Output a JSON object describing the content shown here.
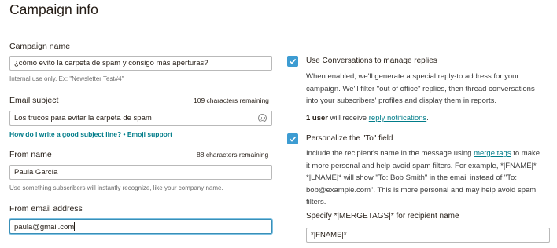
{
  "page": {
    "title": "Campaign info"
  },
  "campaign_name": {
    "label": "Campaign name",
    "value": "¿cómo evito la carpeta de spam y consigo más aperturas?",
    "help": "Internal use only. Ex: \"Newsletter Test#4\""
  },
  "email_subject": {
    "label": "Email subject",
    "remaining": "109 characters remaining",
    "value": "Los trucos para evitar la carpeta de spam",
    "emoji_icon": "emoji-icon",
    "link_subject": "How do I write a good subject line?",
    "link_separator": " • ",
    "link_emoji": "Emoji support"
  },
  "from_name": {
    "label": "From name",
    "remaining": "88 characters remaining",
    "value": "Paula García",
    "help": "Use something subscribers will instantly recognize, like your company name."
  },
  "from_email": {
    "label": "From email address",
    "value": "paula@gmail.com"
  },
  "conversations": {
    "checked": true,
    "label": "Use Conversations to manage replies",
    "desc_1": "When enabled, we'll generate a special reply-to address for your",
    "desc_2": "campaign. We'll filter \"out of office\" replies, then thread conversations",
    "desc_3": "into your subscribers' profiles and display them in reports.",
    "user_count": "1 user",
    "user_text": " will receive ",
    "user_link": "reply notifications",
    "user_end": "."
  },
  "personalize": {
    "checked": true,
    "label": "Personalize the \"To\" field",
    "line1_a": "Include the recipient's name in the message using ",
    "line1_link": "merge tags",
    "line1_b": " to make",
    "line2": "it more personal and help avoid spam filters. For example, *|FNAME|*",
    "line3": "*|LNAME|* will show \"To: Bob Smith\" in the email instead of \"To:",
    "line4": "bob@example.com\". This is more personal and may help avoid spam",
    "line5": "filters.",
    "specify_label": "Specify *|MERGETAGS|* for recipient name",
    "specify_value": "*|FNAME|*"
  },
  "colors": {
    "accent": "#3d9cd2",
    "link": "#007c89",
    "focus": "#7fc2e3"
  }
}
